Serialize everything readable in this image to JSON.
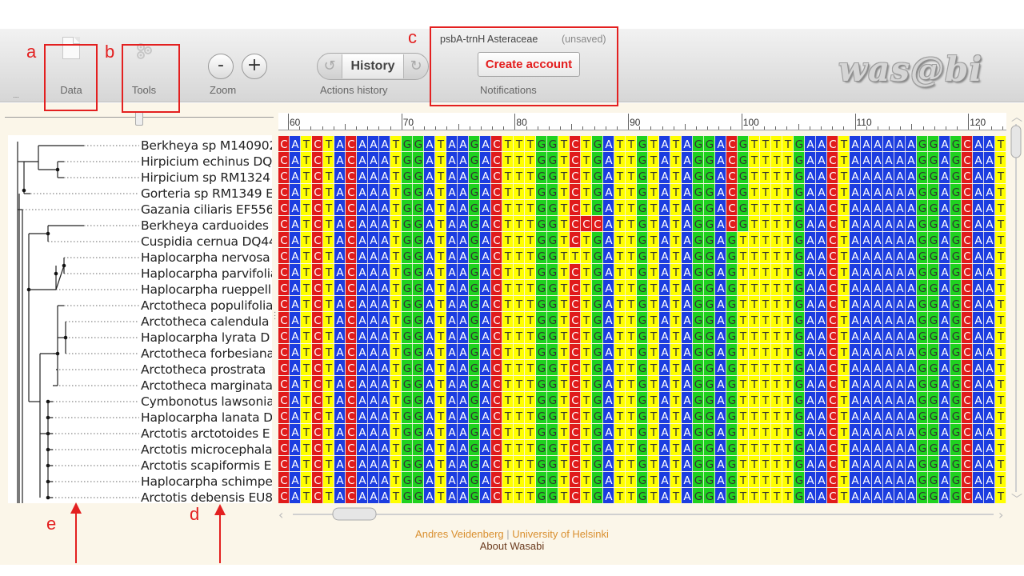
{
  "toolbar": {
    "data_label": "Data",
    "tools_label": "Tools",
    "zoom_label": "Zoom",
    "zoom_out": "-",
    "zoom_in": "+",
    "history_button": "History",
    "history_label": "Actions history",
    "dataset_name": "psbA-trnH Asteraceae",
    "unsaved": "(unsaved)",
    "create_account": "Create account",
    "notifications_label": "Notifications",
    "logo": "was@bi",
    "menu_dots": "..."
  },
  "annotations": {
    "a": "a",
    "b": "b",
    "c": "c",
    "d": "d",
    "e": "e"
  },
  "species": [
    "Berkheya sp M140902",
    "Hirpicium echinus DQ",
    "Hirpicium sp RM1324",
    "Gorteria sp RM1349 E",
    "Gazania ciliaris EF556",
    "Berkheya carduoides",
    "Cuspidia cernua DQ44",
    "Haplocarpha nervosa",
    "Haplocarpha parvifolia",
    "Haplocarpha rueppellii",
    "Arctotheca populifolia",
    "Arctotheca calendula",
    "Haplocarpha lyrata D",
    "Arctotheca forbesiana",
    "Arctotheca prostrata",
    "Arctotheca marginata",
    "Cymbonotus lawsonia",
    "Haplocarpha lanata D",
    "Arctotis arctotoides E",
    "Arctotis microcephala",
    "Arctotis scapiformis E",
    "Haplocarpha schimpe",
    "Arctotis debensis EU8"
  ],
  "ruler": {
    "ticks": [
      "60",
      "70",
      "80",
      "90",
      "100",
      "110",
      "120"
    ]
  },
  "alignment": {
    "consensus": "CATCTACAAATGGATAAGACTTTGGTCTGATTGTATAGGAGTTTTTGAACTAAAAAAGGAGCAAT",
    "variants": {
      "0": {
        "40": "C",
        "41": "G"
      },
      "1": {
        "40": "C",
        "41": "G"
      },
      "2": {
        "40": "C",
        "41": "G"
      },
      "3": {
        "40": "C",
        "41": "G"
      },
      "4": {
        "40": "C",
        "41": "G"
      },
      "5": {
        "40": "C",
        "41": "G",
        "27": "C",
        "28": "C"
      },
      "6": {
        "27": "T"
      },
      "7": {
        "27": "T",
        "26": "T"
      }
    },
    "colors": {
      "A": "#1c3de0",
      "C": "#e01b1b",
      "G": "#1fd21f",
      "T": "#ffff00"
    }
  },
  "footer": {
    "author": "Andres Veidenberg",
    "separator": "|",
    "university": "University of Helsinki",
    "about": "About Wasabi"
  }
}
